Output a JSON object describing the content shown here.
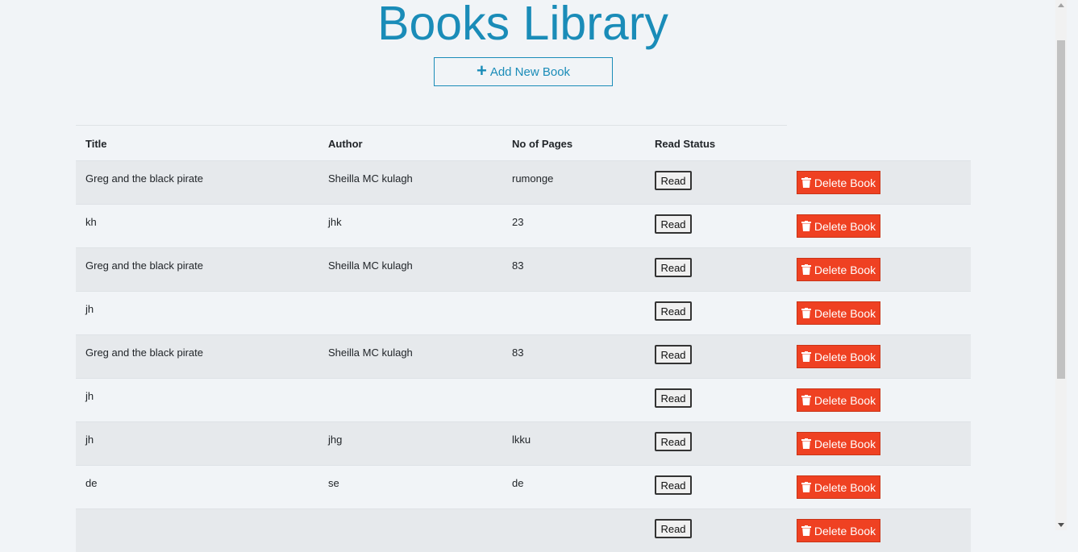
{
  "header": {
    "title": "Books Library",
    "add_button_label": "Add New Book",
    "add_button_icon": "plus-icon"
  },
  "table": {
    "columns": [
      "Title",
      "Author",
      "No of Pages",
      "Read Status"
    ],
    "read_button_label": "Read",
    "delete_button_label": "Delete Book",
    "delete_icon": "trash-icon",
    "rows": [
      {
        "title": "Greg and the black pirate",
        "author": "Sheilla MC kulagh",
        "pages": "rumonge"
      },
      {
        "title": "kh",
        "author": "jhk",
        "pages": "23"
      },
      {
        "title": "Greg and the black pirate",
        "author": "Sheilla MC kulagh",
        "pages": "83"
      },
      {
        "title": "jh",
        "author": "",
        "pages": ""
      },
      {
        "title": "Greg and the black pirate",
        "author": "Sheilla MC kulagh",
        "pages": "83"
      },
      {
        "title": "jh",
        "author": "",
        "pages": ""
      },
      {
        "title": "jh",
        "author": "jhg",
        "pages": "lkku"
      },
      {
        "title": "de",
        "author": "se",
        "pages": "de"
      },
      {
        "title": "",
        "author": "",
        "pages": ""
      }
    ]
  },
  "colors": {
    "accent": "#1a8cb8",
    "delete": "#ef4122",
    "background": "#f1f4f7",
    "row_striped": "#e6e9ec"
  }
}
